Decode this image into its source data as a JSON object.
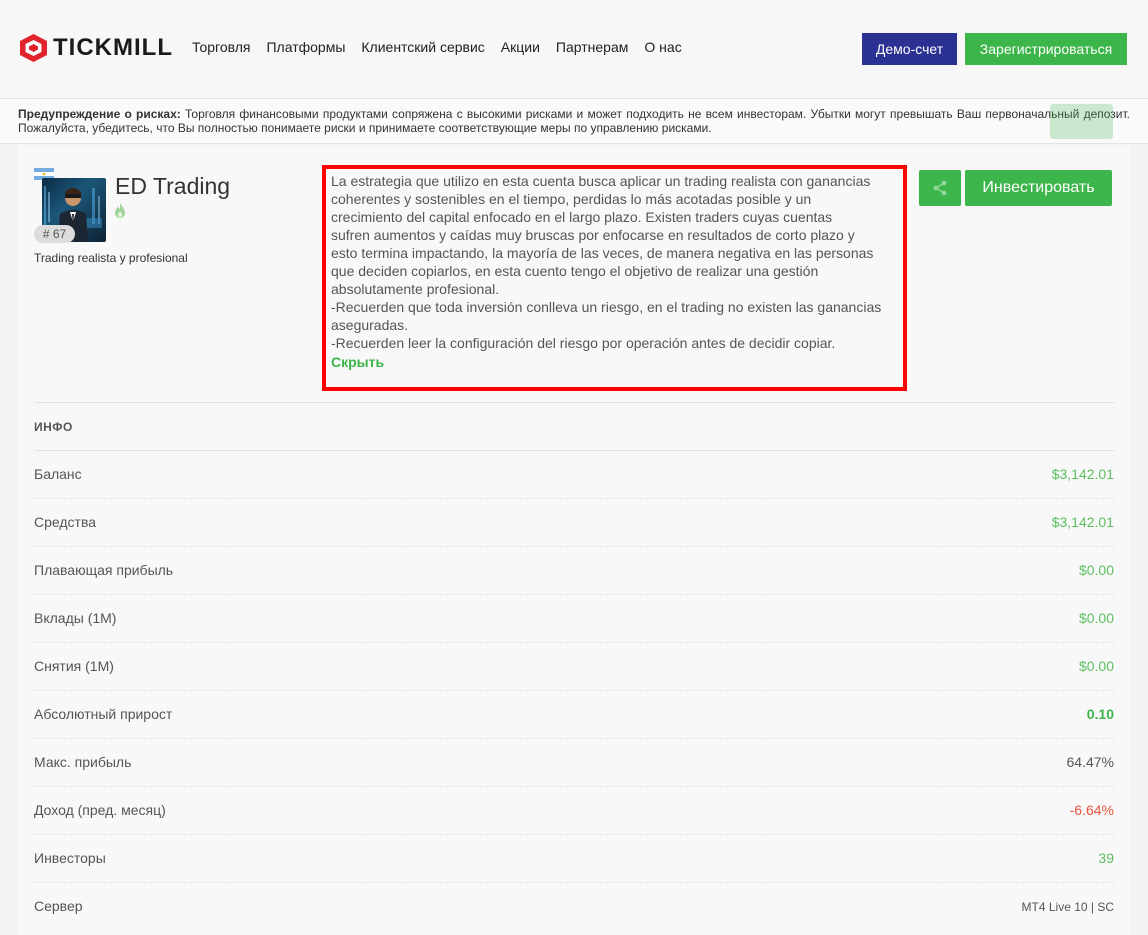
{
  "header": {
    "logo_text": "TICKMILL",
    "nav": [
      "Торговля",
      "Платформы",
      "Клиентский сервис",
      "Акции",
      "Партнерам",
      "О нас"
    ],
    "demo_label": "Демо-счет",
    "register_label": "Зарегистрироваться"
  },
  "risk": {
    "title": "Предупреждение о рисках:",
    "text": "Торговля финансовыми продуктами сопряжена с высокими рисками и может подходить не всем инвесторам. Убытки могут превышать Ваш первоначальный депозит. Пожалуйста, убедитесь, что Вы полностью понимаете риски и принимаете соответствующие меры по управлению рисками."
  },
  "trader": {
    "name": "ED Trading",
    "rank": "# 67",
    "subtitle": "Trading realista y profesional",
    "flag": "argentina-flag",
    "description_lines": [
      "La estrategia que utilizo en esta cuenta busca aplicar un trading realista con ganancias",
      "coherentes y sostenibles en el tiempo, perdidas lo más acotadas posible y un",
      "crecimiento del capital enfocado en el largo plazo. Existen traders cuyas cuentas",
      "sufren aumentos y caídas muy bruscas por enfocarse en resultados de corto plazo y",
      "esto termina impactando, la mayoría de las veces, de manera negativa en las personas",
      "que deciden copiarlos, en esta cuento tengo el objetivo de realizar una gestión",
      "absolutamente profesional.",
      "-Recuerden que toda inversión conlleva un riesgo, en el trading no existen las ganancias",
      "aseguradas.",
      "-Recuerden leer la configuración del riesgo por operación antes de decidir copiar."
    ],
    "hide_label": "Скрыть",
    "invest_label": "Инвестировать"
  },
  "info": {
    "heading": "ИНФО",
    "rows": [
      {
        "label": "Баланс",
        "value": "$3,142.01",
        "style": "v-green"
      },
      {
        "label": "Средства",
        "value": "$3,142.01",
        "style": "v-green"
      },
      {
        "label": "Плавающая прибыль",
        "value": "$0.00",
        "style": "v-green"
      },
      {
        "label": "Вклады (1M)",
        "value": "$0.00",
        "style": "v-green"
      },
      {
        "label": "Снятия (1M)",
        "value": "$0.00",
        "style": "v-green"
      },
      {
        "label": "Абсолютный прирост",
        "value": "0.10",
        "style": "v-bold"
      },
      {
        "label": "Макс. прибыль",
        "value": "64.47%",
        "style": "v-gray"
      },
      {
        "label": "Доход (пред. месяц)",
        "value": "-6.64%",
        "style": "v-red"
      },
      {
        "label": "Инвесторы",
        "value": "39",
        "style": "v-green"
      },
      {
        "label": "Сервер",
        "value": "MT4 Live 10 | SC",
        "style": "v-small"
      }
    ]
  },
  "colors": {
    "brand_green": "#3cb54a",
    "brand_navy": "#2b3192",
    "logo_red": "#e0232b",
    "negative": "#e8533b",
    "highlight_border": "#ff0000"
  }
}
